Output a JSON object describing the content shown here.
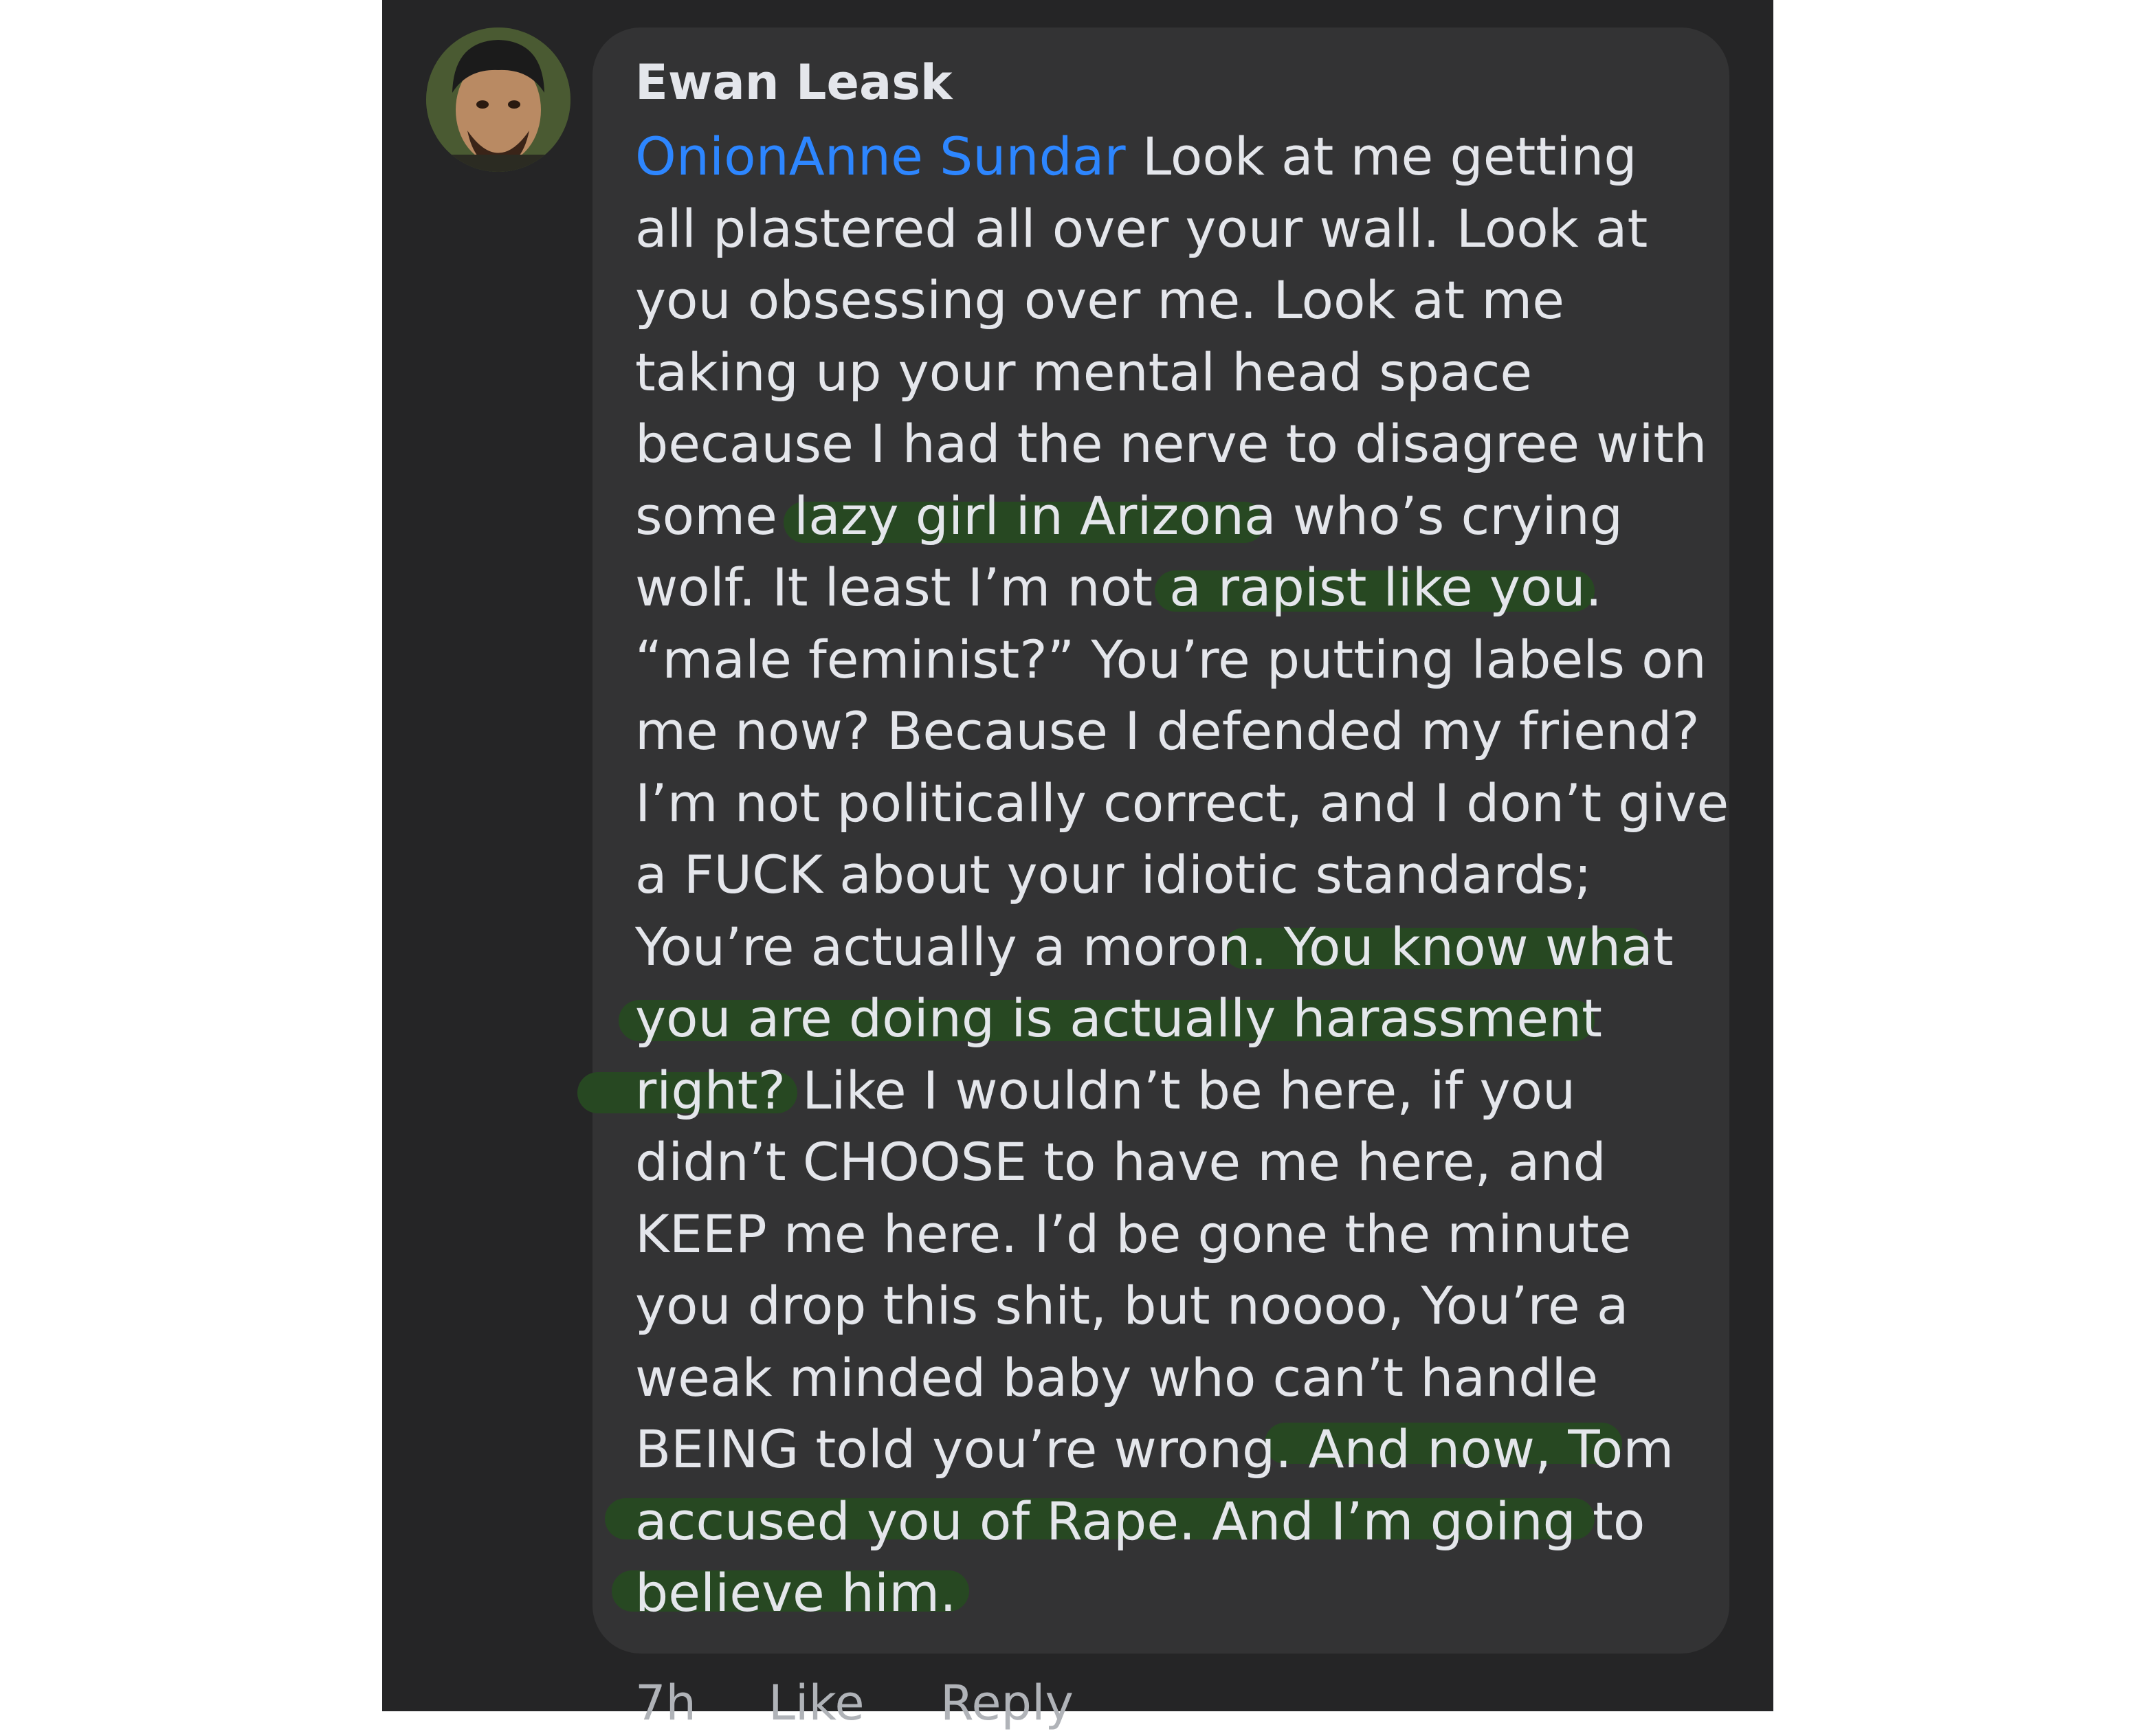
{
  "comment": {
    "author": "Ewan Leask",
    "mention": "OnionAnne Sundar",
    "lines": [
      " Look at me getting",
      "all plastered all over your wall.  Look at",
      "you obsessing over me. Look at me",
      "taking up your mental head space",
      "because I had the nerve to disagree with",
      "some lazy girl in Arizona who’s crying",
      "wolf.  It least I’m not a rapist like you.",
      "“male feminist?” You’re putting labels on",
      "me now? Because I defended my friend?",
      "I’m not politically correct, and I don’t give",
      "a FUCK about your idiotic standards;",
      "You’re actually a moron. You know what",
      "you are doing is actually harassment",
      "right? Like I wouldn’t be here, if you",
      "didn’t CHOOSE to have me here, and",
      "KEEP me here. I’d be gone the minute",
      "you drop this shit, but noooo, You’re a",
      "weak minded baby who can’t handle",
      "BEING told you’re wrong. And now, Tom",
      "accused you of Rape. And I’m going to",
      "believe him."
    ]
  },
  "actions": {
    "time": "7h",
    "like": "Like",
    "reply": "Reply"
  },
  "colors": {
    "background": "#252526",
    "bubble": "#333334",
    "text": "#e4e6eb",
    "mention": "#2d86ff",
    "highlight": "#274a22"
  }
}
